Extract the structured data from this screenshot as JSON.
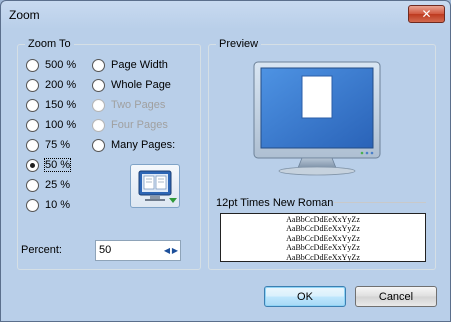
{
  "window": {
    "title": "Zoom",
    "close_label": "✕"
  },
  "zoom_to": {
    "legend": "Zoom To",
    "options_left": [
      {
        "label": "500 %",
        "checked": false,
        "disabled": false
      },
      {
        "label": "200 %",
        "checked": false,
        "disabled": false
      },
      {
        "label": "150 %",
        "checked": false,
        "disabled": false
      },
      {
        "label": "100 %",
        "checked": false,
        "disabled": false
      },
      {
        "label": "75 %",
        "checked": false,
        "disabled": false
      },
      {
        "label": "50 %",
        "checked": true,
        "disabled": false
      },
      {
        "label": "25 %",
        "checked": false,
        "disabled": false
      },
      {
        "label": "10 %",
        "checked": false,
        "disabled": false
      }
    ],
    "options_right": [
      {
        "label": "Page Width",
        "checked": false,
        "disabled": false
      },
      {
        "label": "Whole Page",
        "checked": false,
        "disabled": false
      },
      {
        "label": "Two Pages",
        "checked": false,
        "disabled": true
      },
      {
        "label": "Four Pages",
        "checked": false,
        "disabled": true
      },
      {
        "label": "Many Pages:",
        "checked": false,
        "disabled": false
      }
    ],
    "percent_label": "Percent:",
    "percent_value": "50"
  },
  "preview": {
    "legend": "Preview",
    "sample_label": "12pt Times New Roman",
    "sample_lines": [
      "AaBbCcDdEeXxYyZz",
      "AaBbCcDdEeXxYyZz",
      "AaBbCcDdEeXxYyZz",
      "AaBbCcDdEeXxYyZz",
      "AaBbCcDdEeXxYyZz"
    ]
  },
  "buttons": {
    "ok": "OK",
    "cancel": "Cancel"
  },
  "icons": {
    "monitor": "monitor-icon",
    "pages": "pages-icon"
  },
  "colors": {
    "monitor_screen": "#3d7fd4",
    "title_bar": "#b9cfe9"
  }
}
